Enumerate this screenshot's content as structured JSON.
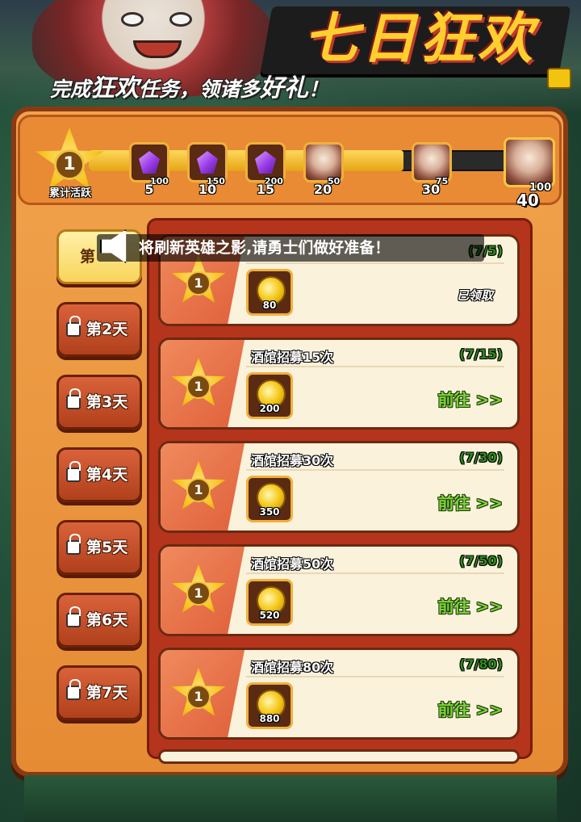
{
  "header": {
    "title": "七日狂欢",
    "subtitle_parts": [
      "完成",
      "狂欢",
      "任务，领诸多",
      "好礼",
      "！"
    ]
  },
  "progress": {
    "current_level": "1",
    "caption": "累计活跃",
    "current_points": "40",
    "fill_fraction": 0.75,
    "milestones": [
      {
        "points": "5",
        "reward": "gem-icon",
        "qty": "100"
      },
      {
        "points": "10",
        "reward": "gem-icon",
        "qty": "150"
      },
      {
        "points": "15",
        "reward": "gem-icon",
        "qty": "200"
      },
      {
        "points": "20",
        "reward": "hero-card",
        "qty": "50"
      },
      {
        "points": "30",
        "reward": "hero-card",
        "qty": "75"
      },
      {
        "points": "40",
        "reward": "hero-card",
        "qty": "100"
      }
    ]
  },
  "days": [
    {
      "label": "第1天",
      "active": true,
      "locked": false
    },
    {
      "label": "第2天",
      "active": false,
      "locked": true
    },
    {
      "label": "第3天",
      "active": false,
      "locked": true
    },
    {
      "label": "第4天",
      "active": false,
      "locked": true
    },
    {
      "label": "第5天",
      "active": false,
      "locked": true
    },
    {
      "label": "第6天",
      "active": false,
      "locked": true
    },
    {
      "label": "第7天",
      "active": false,
      "locked": true
    }
  ],
  "active_day_visible_label": "第",
  "notice": {
    "text": "将刷新英雄之影,请勇士们做好准备！"
  },
  "tasks": [
    {
      "title": "",
      "progress": "(7/5)",
      "star": "1",
      "reward_qty": "80",
      "action": "已领取"
    },
    {
      "title": "酒馆招募15次",
      "progress": "(7/15)",
      "star": "1",
      "reward_qty": "200",
      "action": "前往 >>"
    },
    {
      "title": "酒馆招募30次",
      "progress": "(7/30)",
      "star": "1",
      "reward_qty": "350",
      "action": "前往 >>"
    },
    {
      "title": "酒馆招募50次",
      "progress": "(7/50)",
      "star": "1",
      "reward_qty": "520",
      "action": "前往 >>"
    },
    {
      "title": "酒馆招募80次",
      "progress": "(7/80)",
      "star": "1",
      "reward_qty": "880",
      "action": "前往 >>"
    }
  ],
  "colors": {
    "panel": "#e58b34",
    "accent_gold": "#ffcf2e",
    "progress_green": "#2e8a1a",
    "goto_green": "#7ed23a"
  }
}
